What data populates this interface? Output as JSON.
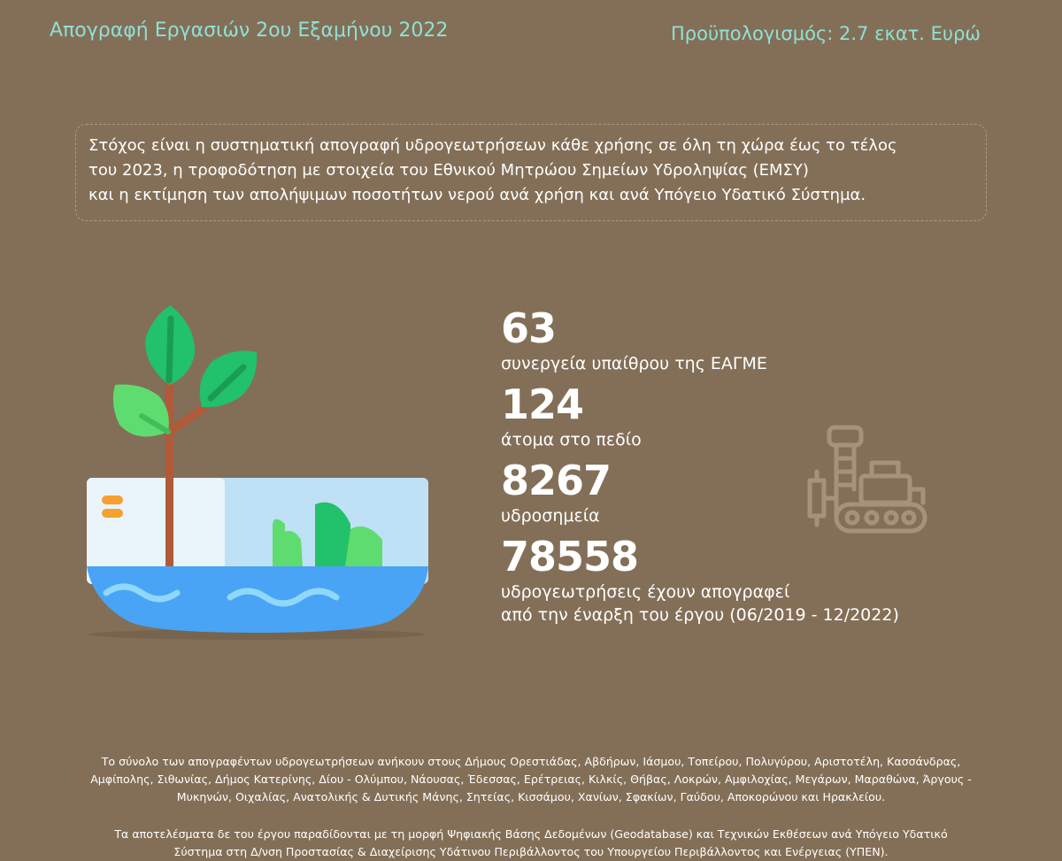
{
  "header": {
    "title": "Απογραφή Εργασιών 2ου Εξαμήνου 2022",
    "budget": "Προϋπολογισμός: 2.7 εκατ. Ευρώ"
  },
  "goal": {
    "lines": [
      "Στόχος είναι η συστηματική απογραφή υδρογεωτρήσεων κάθε χρήσης σε όλη τη χώρα έως το τέλος",
      "του 2023, η τροφοδότηση με στοιχεία του Εθνικού Μητρώου Σημείων Υδροληψίας (ΕΜΣΥ)",
      "και η εκτίμηση των απολήψιμων ποσοτήτων νερού ανά χρήση και ανά Υπόγειο Υδατικό Σύστημα."
    ]
  },
  "stats": [
    {
      "value": "63",
      "label": "συνεργεία υπαίθρου της ΕΑΓΜΕ"
    },
    {
      "value": "124",
      "label": "άτομα στο πεδίο"
    },
    {
      "value": "8267",
      "label": "υδροσημεία"
    },
    {
      "value": "78558",
      "label": "υδρογεωτρήσεις έχουν απογραφεί",
      "label2": "από την έναρξη του έργου (06/2019 - 12/2022)"
    }
  ],
  "footer": {
    "p1": [
      "Το σύνολο των απογραφέντων υδρογεωτρήσεων ανήκουν στους Δήμους Ορεστιάδας, Αβδήρων, Ιάσμου, Τοπείρου, Πολυγύρου, Αριστοτέλη, Κασσάνδρας,",
      "Αμφίπολης, Σιθωνίας, Δήμος Κατερίνης, Δίου - Ολύμπου, Νάουσας, Έδεσσας, Ερέτρειας, Κιλκίς, Θήβας, Λοκρών, Αμφιλοχίας, Μεγάρων, Μαραθώνα, Άργους -",
      "Μυκηνών, Οιχαλίας, Ανατολικής & Δυτικής Μάνης, Σητείας, Κισσάμου, Χανίων, Σφακίων, Γαύδου, Αποκορώνου και Ηρακλείου."
    ],
    "p2": [
      "Τα αποτελέσματα δε του έργου παραδίδονται με τη μορφή Ψηφιακής Βάσης Δεδομένων (Geodatabase) και Τεχνικών Εκθέσεων ανά Υπόγειο Υδατικό",
      "Σύστημα στη Δ/νση Προστασίας & Διαχείρισης Υδάτινου Περιβάλλοντος του Υπουργείου Περιβάλλοντος και Ενέργειας (ΥΠΕΝ)."
    ]
  },
  "colors": {
    "background": "#836f57",
    "accent": "#8fe0d6",
    "leaf_dark": "#22c16b",
    "leaf_light": "#5fdc6f",
    "water": "#49a4f5",
    "stem": "#b05a3a"
  },
  "icons": {
    "illustration": "plant-in-water-pot-icon",
    "machine": "drilling-rig-icon"
  }
}
